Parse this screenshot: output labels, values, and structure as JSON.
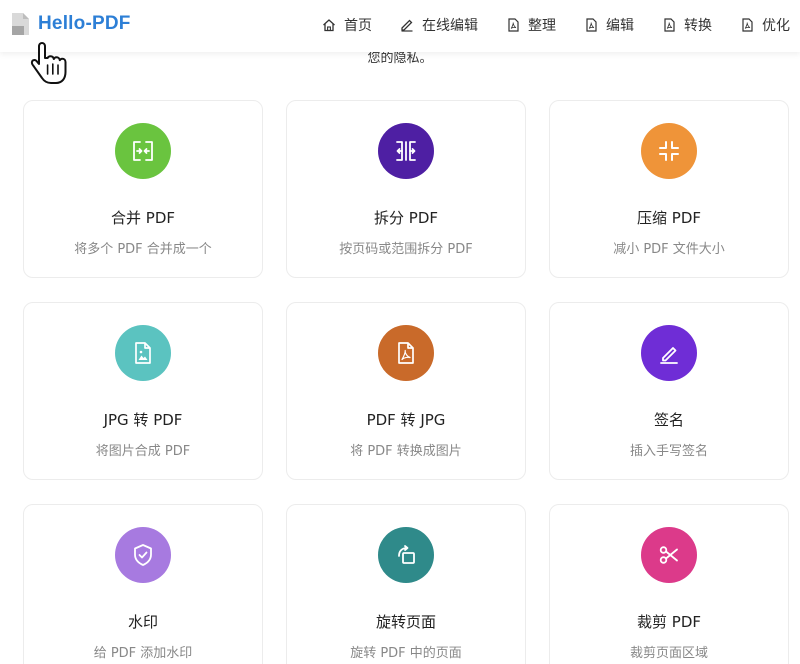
{
  "brand": {
    "name": "Hello-PDF",
    "logo_icon": "pdf-file-logo-icon"
  },
  "nav": [
    {
      "label": "首页",
      "icon": "home-icon"
    },
    {
      "label": "在线编辑",
      "icon": "pencil-icon"
    },
    {
      "label": "整理",
      "icon": "pdf-file-icon"
    },
    {
      "label": "编辑",
      "icon": "pdf-file-icon"
    },
    {
      "label": "转换",
      "icon": "pdf-file-icon"
    },
    {
      "label": "优化",
      "icon": "pdf-file-icon"
    }
  ],
  "intro_tail": "您的隐私。",
  "tools": [
    {
      "title": "合并 PDF",
      "desc": "将多个 PDF 合并成一个",
      "icon": "merge-icon",
      "color": "#6ac43f"
    },
    {
      "title": "拆分 PDF",
      "desc": "按页码或范围拆分 PDF",
      "icon": "split-icon",
      "color": "#4e1fa3"
    },
    {
      "title": "压缩 PDF",
      "desc": "减小 PDF 文件大小",
      "icon": "compress-icon",
      "color": "#ef9439"
    },
    {
      "title": "JPG 转 PDF",
      "desc": "将图片合成 PDF",
      "icon": "image-file-icon",
      "color": "#5bc3c0"
    },
    {
      "title": "PDF 转 JPG",
      "desc": "将 PDF 转换成图片",
      "icon": "pdf-file-icon",
      "color": "#c96a2a"
    },
    {
      "title": "签名",
      "desc": "插入手写签名",
      "icon": "signature-icon",
      "color": "#6f2dd6"
    },
    {
      "title": "水印",
      "desc": "给 PDF 添加水印",
      "icon": "shield-check-icon",
      "color": "#a77ae0"
    },
    {
      "title": "旋转页面",
      "desc": "旋转 PDF 中的页面",
      "icon": "rotate-icon",
      "color": "#2f8a8a"
    },
    {
      "title": "裁剪 PDF",
      "desc": "裁剪页面区域",
      "icon": "scissors-icon",
      "color": "#dc3a8a"
    }
  ]
}
